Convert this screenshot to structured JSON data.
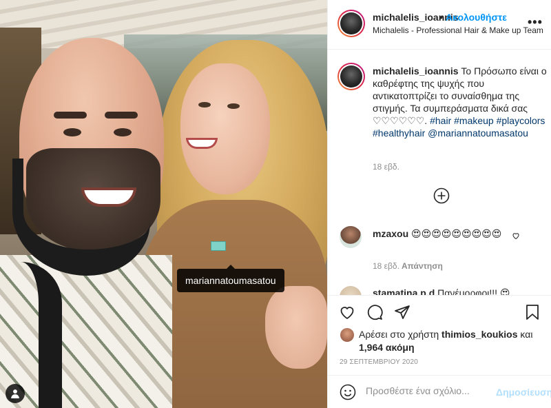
{
  "photo": {
    "tag_label": "mariannatoumasatou"
  },
  "header": {
    "username": "michalelis_ioannis",
    "separator": "•",
    "follow_label": "Ακολουθήστε",
    "subtitle": "Michalelis - Professional Hair & Make up Team",
    "more_icon": "more-horizontal-icon"
  },
  "caption": {
    "username": "michalelis_ioannis",
    "text": "Το Πρόσωπο είναι ο καθρέφτης της ψυχής που αντικατοπτρίζει το συναίσθημα της στιγμής. Τα συμπεράσματα δικά σας",
    "hearts": "♡♡♡♡♡♡.",
    "tags": [
      "#hair",
      "#makeup",
      "#playcolors",
      "#healthyhair"
    ],
    "mention": "@mariannatoumasatou",
    "time": "18 εβδ."
  },
  "load_more_icon": "plus-circle-icon",
  "comments": [
    {
      "username": "mzaxou",
      "text": "😍😍😍😍😍😍😍😍😍",
      "time": "18 εβδ.",
      "reply_label": "Απάντηση"
    },
    {
      "username": "stamatina.p.d",
      "text": "Πανέμορφοι!!! 😍"
    }
  ],
  "actions": {
    "like_icon": "heart-icon",
    "comment_icon": "comment-icon",
    "share_icon": "share-icon",
    "save_icon": "bookmark-icon"
  },
  "likes": {
    "prefix": "Αρέσει στο χρήστη",
    "user": "thimios_koukios",
    "conj": "και",
    "count": "1,964 ακόμη"
  },
  "date": "29 ΣΕΠΤΕΜΒΡΙΟΥ 2020",
  "add_comment": {
    "placeholder": "Προσθέστε ένα σχόλιο...",
    "post_label": "Δημοσίευση"
  },
  "colors": {
    "accent": "#0095f6",
    "link": "#00376b",
    "muted": "#8e8e8e",
    "post_disabled": "#b2dffc"
  }
}
